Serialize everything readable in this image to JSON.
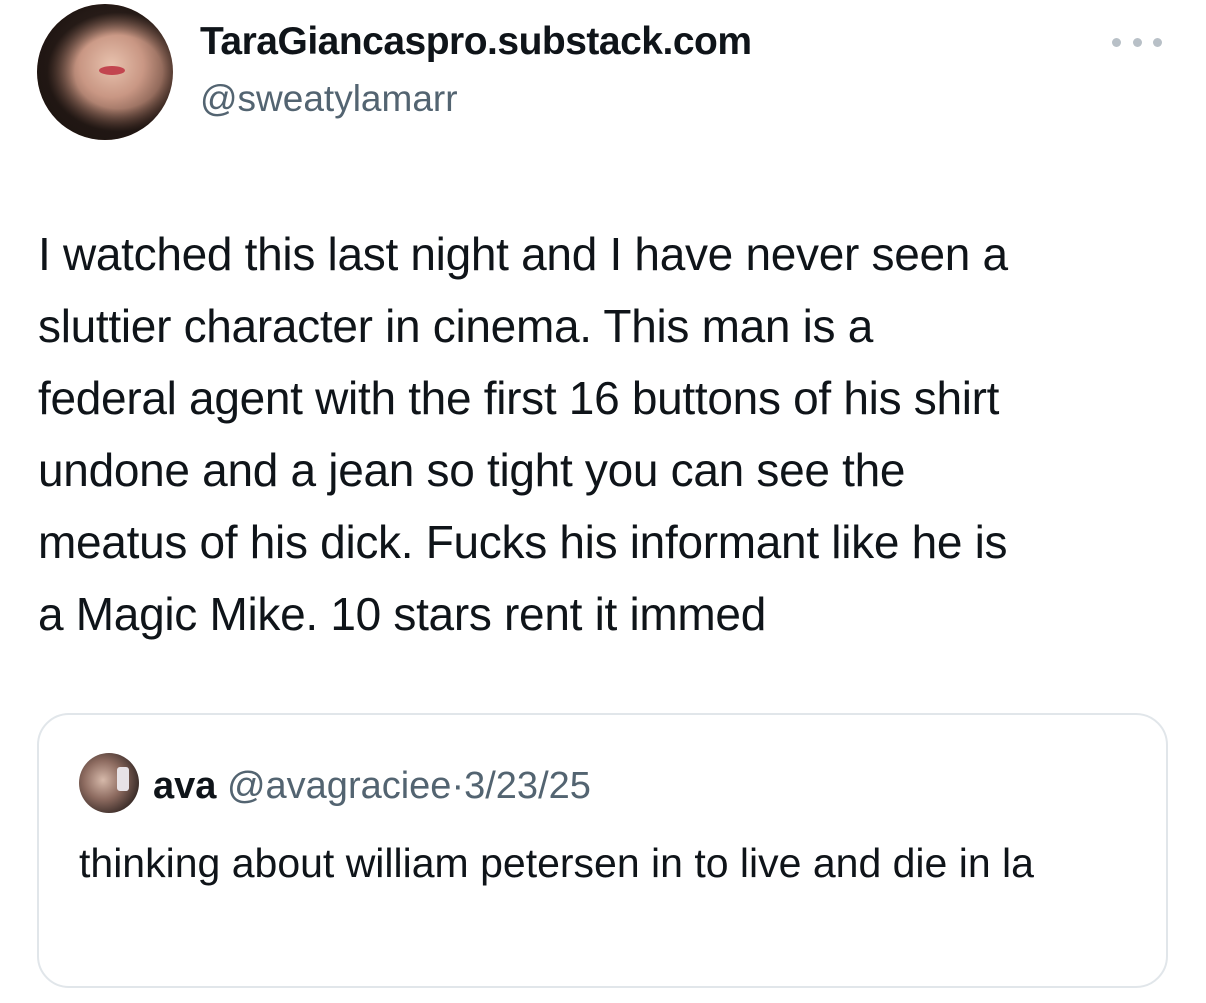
{
  "author": {
    "display_name": "TaraGiancaspro.substack.com",
    "handle": "@sweatylamarr"
  },
  "tweet": {
    "text": "I watched this last night and I have never seen a\nsluttier character in cinema. This man is a\nfederal agent with the first 16 buttons of his shirt\nundone and a jean so tight you can see the\nmeatus of his dick. Fucks his informant like he is\na Magic Mike. 10 stars rent it immed"
  },
  "quoted_tweet": {
    "name": "ava",
    "handle": "@avagraciee",
    "separator": "·",
    "date": "3/23/25",
    "text": "thinking about william petersen in to live and die in la"
  },
  "icons": {
    "more": "more-horizontal-icon"
  },
  "colors": {
    "text_primary": "#0f1419",
    "text_secondary": "#536471",
    "border": "#e1e6ea"
  }
}
